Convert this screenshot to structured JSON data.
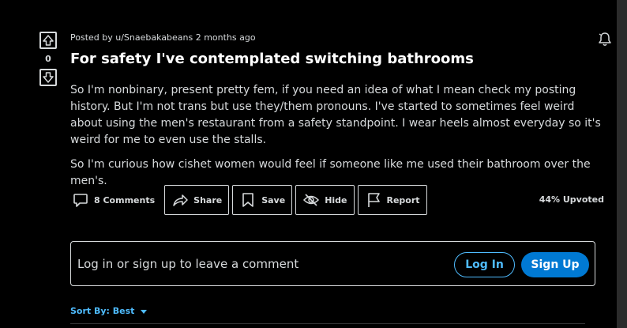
{
  "post": {
    "meta": "Posted by u/Snaebakabeans 2 months ago",
    "title": "For safety I've contemplated switching bathrooms",
    "paragraphs": [
      "So I'm nonbinary, present pretty fem, if you need an idea of what I mean check my posting history. But I'm not trans but use they/them pronouns. I've started to sometimes feel weird about using the men's restaurant from a safety standpoint. I wear heels almost everyday so it's weird for me to even use the stalls.",
      "So I'm curious how cishet women would feel if someone like me used their bathroom over the men's."
    ],
    "score": "0",
    "upvoted": "44% Upvoted"
  },
  "actions": {
    "comments": "8 Comments",
    "share": "Share",
    "save": "Save",
    "hide": "Hide",
    "report": "Report"
  },
  "login": {
    "prompt": "Log in or sign up to leave a comment",
    "login_label": "Log In",
    "signup_label": "Sign Up"
  },
  "sort": {
    "label": "Sort By: Best"
  },
  "icons": {
    "upvote": "arrow-up-icon",
    "downvote": "arrow-down-icon",
    "bell": "bell-icon",
    "comments": "comment-icon",
    "share": "share-icon",
    "save": "bookmark-icon",
    "hide": "eye-slash-icon",
    "report": "flag-icon",
    "sort": "caret-down-icon"
  },
  "colors": {
    "background": "#000000",
    "text": "#d7dadc",
    "accent": "#4fbcff",
    "signup": "#0079d3"
  }
}
